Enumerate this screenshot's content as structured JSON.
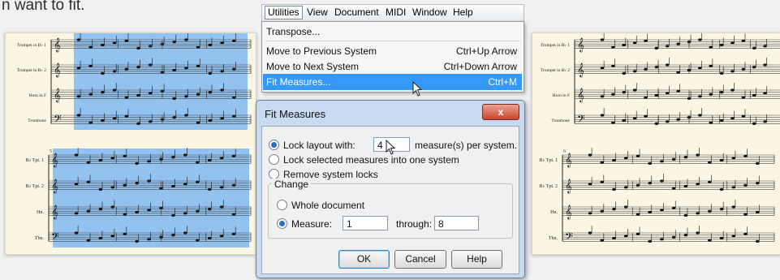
{
  "intro_text": "n want to fit.",
  "menubar": {
    "items": [
      "Utilities",
      "View",
      "Document",
      "MIDI",
      "Window",
      "Help"
    ]
  },
  "utilities_menu": {
    "transpose": "Transpose...",
    "move_previous": {
      "label": "Move to Previous System",
      "shortcut": "Ctrl+Up Arrow"
    },
    "move_next": {
      "label": "Move to Next System",
      "shortcut": "Ctrl+Down Arrow"
    },
    "fit_measures": {
      "label": "Fit Measures...",
      "shortcut": "Ctrl+M"
    }
  },
  "dialog": {
    "title": "Fit Measures",
    "close": "x",
    "lock_layout_label": "Lock layout with:",
    "lock_layout_value": "4",
    "lock_layout_suffix": "measure(s) per system.",
    "lock_selected_label": "Lock selected measures into one system",
    "remove_locks_label": "Remove system locks",
    "change_group": "Change",
    "whole_document_label": "Whole document",
    "measure_label": "Measure:",
    "measure_from": "1",
    "through_label": "through:",
    "measure_to": "8",
    "ok": "OK",
    "cancel": "Cancel",
    "help": "Help"
  },
  "scores": {
    "left_top_staves": [
      "Trumpet in B♭ 1",
      "Trumpet in B♭ 2",
      "Horn in F",
      "Trombone"
    ],
    "left_bottom_staves": [
      "B♭ Tpt. 1",
      "B♭ Tpt. 2",
      "Hn.",
      "Tbn."
    ],
    "right_top_staves": [
      "Trumpet in B♭ 1",
      "Trumpet in B♭ 2",
      "Horn in F",
      "Trombone"
    ],
    "right_bottom_staves": [
      "B♭ Tpt. 1",
      "B♭ Tpt. 2",
      "Hn.",
      "Tbn."
    ],
    "left_bottom_measure_number": "5",
    "right_bottom_measure_number": "6"
  },
  "colors": {
    "selection": "#7fb8f2",
    "menu_highlight": "#3399ff",
    "paper": "#fbf5e3"
  }
}
